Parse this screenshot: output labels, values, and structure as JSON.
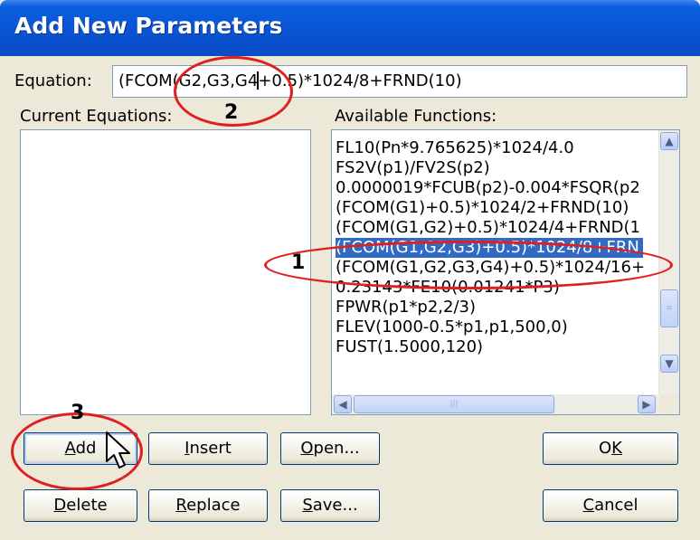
{
  "window": {
    "title": "Add New Parameters"
  },
  "equation": {
    "label": "Equation:",
    "value_before_caret": "(FCOM(G2,G3,G4",
    "value_after_caret": "+0.5)*1024/8+FRND(10)"
  },
  "current_equations": {
    "label": "Current Equations:",
    "items": []
  },
  "available_functions": {
    "label": "Available Functions:",
    "items": [
      "FL10(Pn*9.765625)*1024/4.0",
      "FS2V(p1)/FV2S(p2)",
      "0.0000019*FCUB(p2)-0.004*FSQR(p2",
      "(FCOM(G1)+0.5)*1024/2+FRND(10)",
      "(FCOM(G1,G2)+0.5)*1024/4+FRND(1",
      "(FCOM(G1,G2,G3)+0.5)*1024/8+FRN",
      "(FCOM(G1,G2,G3,G4)+0.5)*1024/16+",
      "0.23143*FE10(0.01241*P3)",
      "FPWR(p1*p2,2/3)",
      "FLEV(1000-0.5*p1,p1,500,0)",
      "FUST(1.5000,120)"
    ],
    "selected_index": 5
  },
  "buttons": {
    "add": {
      "hotkey": "A",
      "rest": "dd"
    },
    "insert": {
      "hotkey": "I",
      "rest": "nsert"
    },
    "open": {
      "hotkey": "O",
      "rest": "pen..."
    },
    "ok": {
      "pre": "O",
      "hotkey": "K"
    },
    "delete": {
      "hotkey": "D",
      "rest": "elete"
    },
    "replace": {
      "hotkey": "R",
      "rest": "eplace"
    },
    "save": {
      "hotkey": "S",
      "rest": "ave..."
    },
    "cancel": {
      "hotkey": "C",
      "rest": "ancel"
    }
  },
  "annotations": {
    "step1": "1",
    "step2": "2",
    "step3": "3",
    "color": "#e02020"
  }
}
